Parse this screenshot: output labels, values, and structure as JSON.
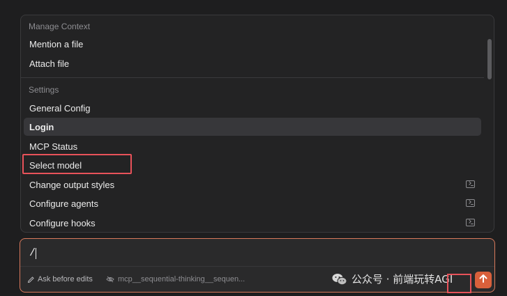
{
  "menu": {
    "sections": [
      {
        "title": "Manage Context",
        "items": [
          {
            "label": "Mention a file"
          },
          {
            "label": "Attach file"
          }
        ]
      },
      {
        "title": "Settings",
        "items": [
          {
            "label": "General Config"
          },
          {
            "label": "Login",
            "active": true
          },
          {
            "label": "MCP Status"
          },
          {
            "label": "Select model",
            "highlighted": true
          },
          {
            "label": "Change output styles",
            "icon": "terminal-icon"
          },
          {
            "label": "Configure agents",
            "icon": "terminal-icon"
          },
          {
            "label": "Configure hooks",
            "icon": "terminal-icon"
          }
        ]
      }
    ]
  },
  "composer": {
    "value": "/",
    "mode_label": "Ask before edits",
    "tool_label": "mcp__sequential-thinking__sequen...",
    "watermark": "公众号 · 前端玩转AGI"
  },
  "colors": {
    "accent": "#d9603b",
    "highlight_box": "#e8525a",
    "panel_bg": "#232324",
    "page_bg": "#1e1e1f"
  }
}
